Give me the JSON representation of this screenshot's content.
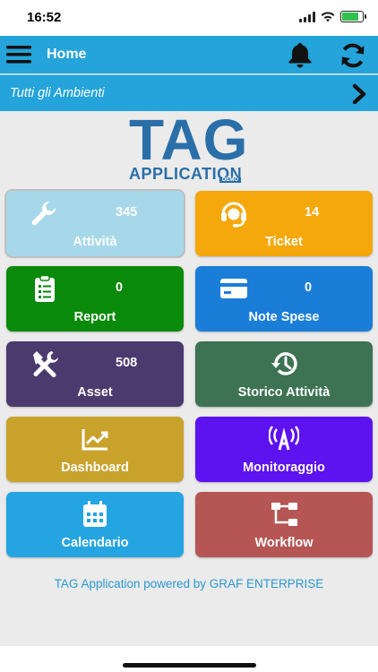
{
  "status_bar": {
    "time": "16:52",
    "battery_level": 0.8,
    "battery_color": "#31c14b"
  },
  "header": {
    "title": "Home",
    "menu_icon": "hamburger-menu-icon",
    "bell_icon": "bell-icon",
    "refresh_icon": "refresh-icon",
    "color": "#24a4da"
  },
  "environment": {
    "label": "Tutti gli Ambienti",
    "chevron_icon": "chevron-right-icon"
  },
  "logo": {
    "main": "TAG",
    "sub": "APPLICATION",
    "badge": "DEMO",
    "color": "#2a6fa8"
  },
  "tiles": [
    {
      "label": "Attività",
      "count": "345",
      "icon": "wrench-icon",
      "color": "#a7d8ea"
    },
    {
      "label": "Ticket",
      "count": "14",
      "icon": "headset-icon",
      "color": "#f4a80b"
    },
    {
      "label": "Report",
      "count": "0",
      "icon": "clipboard-icon",
      "color": "#0a8a0a"
    },
    {
      "label": "Note Spese",
      "count": "0",
      "icon": "credit-card-icon",
      "color": "#1a7ed8"
    },
    {
      "label": "Asset",
      "count": "508",
      "icon": "tools-icon",
      "color": "#4a3a6e"
    },
    {
      "label": "Storico Attività",
      "count": "",
      "icon": "history-icon",
      "color": "#3d7353"
    },
    {
      "label": "Dashboard",
      "count": "",
      "icon": "line-chart-icon",
      "color": "#c9a22c"
    },
    {
      "label": "Monitoraggio",
      "count": "",
      "icon": "antenna-icon",
      "color": "#5d12f0"
    },
    {
      "label": "Calendario",
      "count": "",
      "icon": "calendar-icon",
      "color": "#24a4e0"
    },
    {
      "label": "Workflow",
      "count": "",
      "icon": "workflow-icon",
      "color": "#b55655"
    }
  ],
  "footer": {
    "text": "TAG Application powered by GRAF ENTERPRISE"
  }
}
